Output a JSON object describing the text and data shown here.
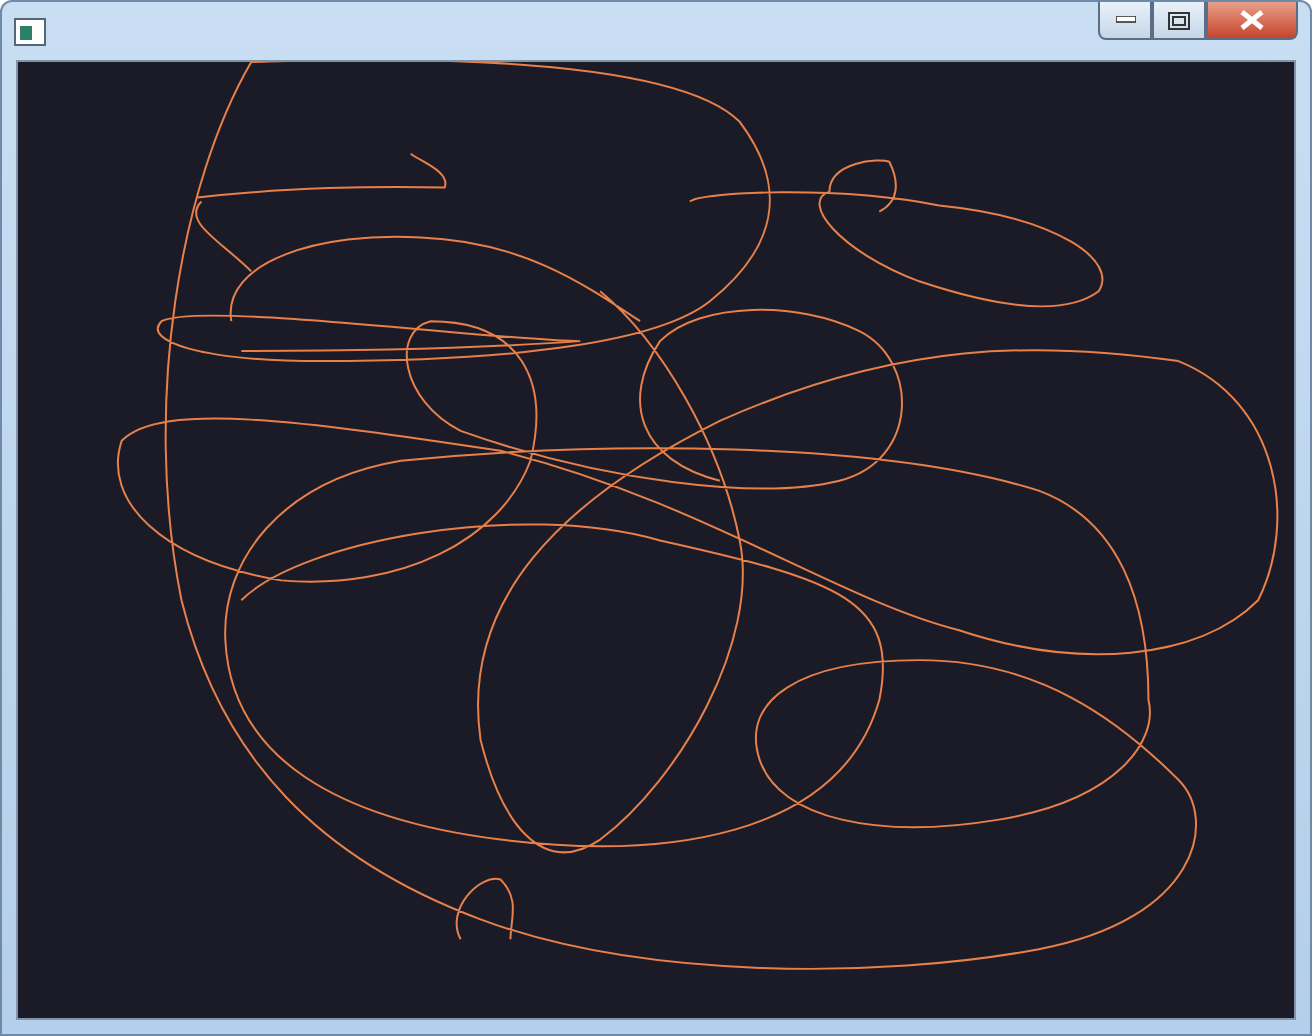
{
  "window": {
    "controls": [
      {
        "kind": "minimize"
      },
      {
        "kind": "maximize"
      },
      {
        "kind": "close"
      }
    ]
  }
}
